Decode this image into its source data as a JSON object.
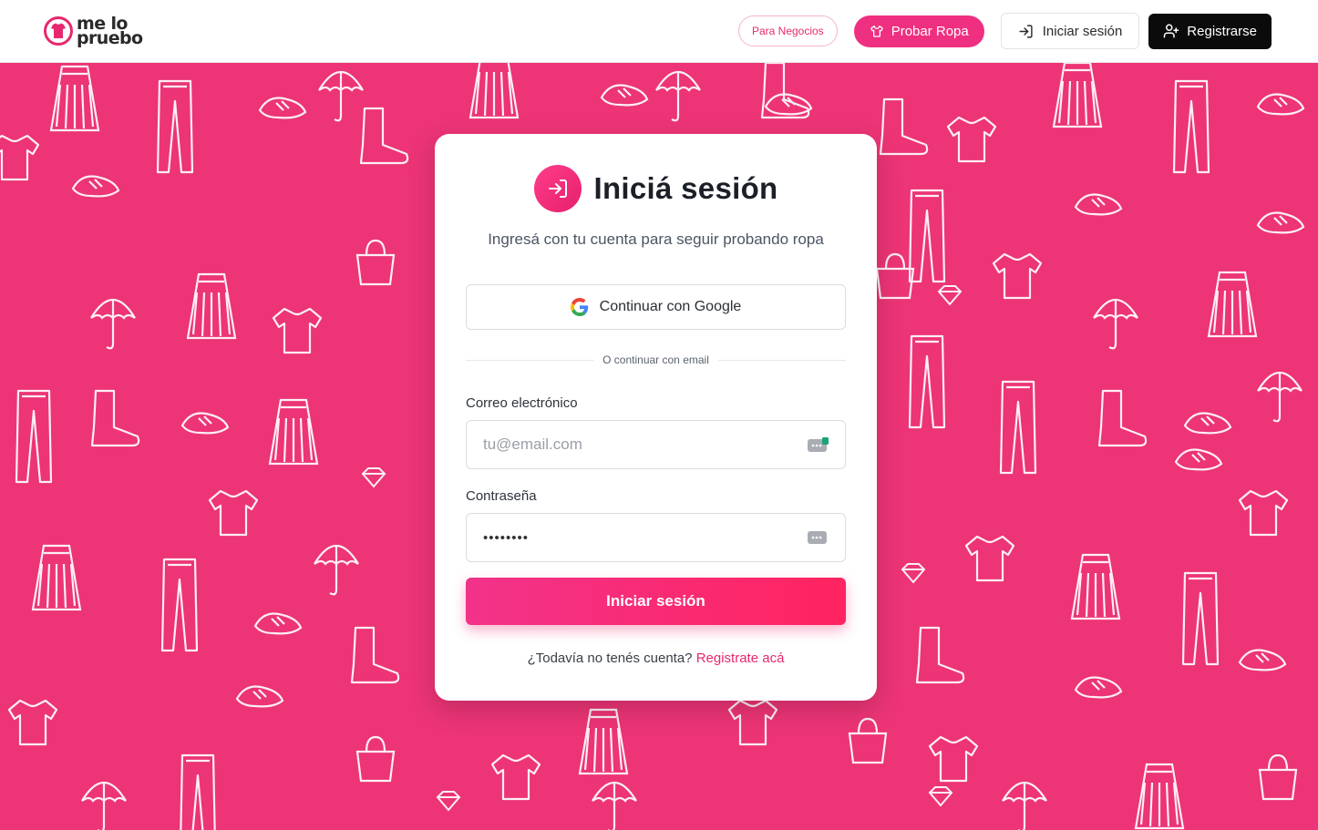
{
  "header": {
    "logo_line1": "me lo",
    "logo_line2": "pruebo",
    "nav": {
      "business_label": "Para Negocios",
      "try_on_label": "Probar Ropa",
      "login_label": "Iniciar sesión",
      "register_label": "Registrarse"
    }
  },
  "login_card": {
    "title": "Iniciá sesión",
    "subtitle": "Ingresá con tu cuenta para seguir probando ropa",
    "google_button_label": "Continuar con Google",
    "divider_text": "O continuar con email",
    "email": {
      "label": "Correo electrónico",
      "placeholder": "tu@email.com",
      "value": ""
    },
    "password": {
      "label": "Contraseña",
      "masked_value": "••••••••"
    },
    "submit_label": "Iniciar sesión",
    "footer_question": "¿Todavía no tenés cuenta?",
    "register_link": "Registrate acá"
  },
  "icons": {
    "logo": "tshirt-logo-icon",
    "try_on": "shirt-icon",
    "login": "log-in-icon",
    "register": "user-plus-icon",
    "title": "log-in-icon",
    "google": "google-icon",
    "autofill": "password-manager-icon"
  },
  "colors": {
    "brand_pink": "#ec3476",
    "accent_pink": "#ef2f80",
    "dark_button": "#0b0b0b",
    "link_pink": "#e6296f"
  }
}
